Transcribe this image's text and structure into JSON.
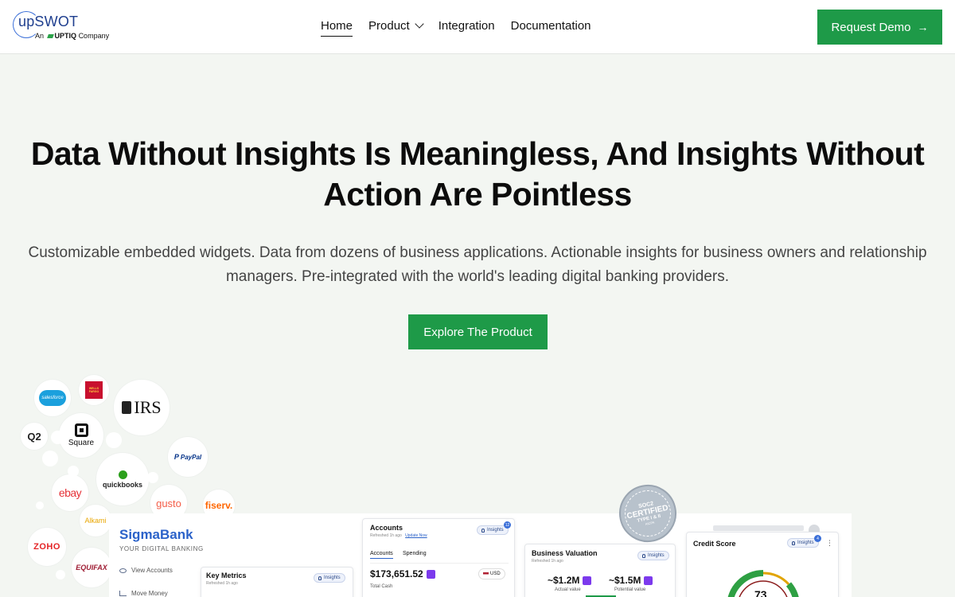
{
  "brand": {
    "name": "upSWOT",
    "sub_prefix": "An",
    "sub_company": "UPTIQ",
    "sub_suffix": "Company"
  },
  "nav": {
    "items": [
      {
        "label": "Home",
        "active": true
      },
      {
        "label": "Product",
        "has_dropdown": true
      },
      {
        "label": "Integration"
      },
      {
        "label": "Documentation"
      }
    ],
    "cta": "Request Demo"
  },
  "hero": {
    "title_line1": "Data Without Insights Is Meaningless, And Insights Without",
    "title_line2": "Action Are Pointless",
    "subtitle_line1": "Customizable embedded widgets. Data from dozens of business applications. Actionable insights for business owners and relationship",
    "subtitle_line2": "managers. Pre-integrated with the world's leading digital banking providers.",
    "cta": "Explore The Product"
  },
  "integrations": {
    "salesforce": "salesforce",
    "wellsfargo": "WELLS FARGO",
    "irs": "IRS",
    "q2": "Q2",
    "square": "Square",
    "paypal": "PayPal",
    "quickbooks": "quickbooks",
    "ebay": "ebay",
    "gusto": "gusto",
    "fiserv": "fiserv.",
    "alkami": "Alkami",
    "zoho": "ZOHO",
    "equifax": "EQUIFAX"
  },
  "seal": {
    "top": "SOC2",
    "middle": "CERTIFIED",
    "bottom": "TYPE I & II",
    "foot": "AICPA"
  },
  "dashboard": {
    "bank_name": "SigmaBank",
    "bank_tagline": "YOUR DIGITAL BANKING",
    "side_links": [
      "View Accounts",
      "Move Money"
    ],
    "key_metrics": {
      "title": "Key Metrics",
      "refreshed": "Refreshed 1h ago",
      "insights": "Insights"
    },
    "accounts": {
      "title": "Accounts",
      "refreshed": "Refreshed 1h ago",
      "update": "Update Now",
      "insights": "Insights",
      "insights_count": "12",
      "tabs": [
        "Accounts",
        "Spending"
      ],
      "amount": "$173,651.52",
      "currency": "USD",
      "amount_label": "Total Cash"
    },
    "valuation": {
      "title": "Business Valuation",
      "refreshed": "Refreshed 1h ago",
      "insights": "Insights",
      "actual": "~$1.2M",
      "actual_label": "Actual value",
      "potential": "~$1.5M",
      "potential_label": "Potential value"
    },
    "credit": {
      "title": "Credit Score",
      "insights": "Insights",
      "insights_count": "4",
      "score": "73"
    }
  }
}
